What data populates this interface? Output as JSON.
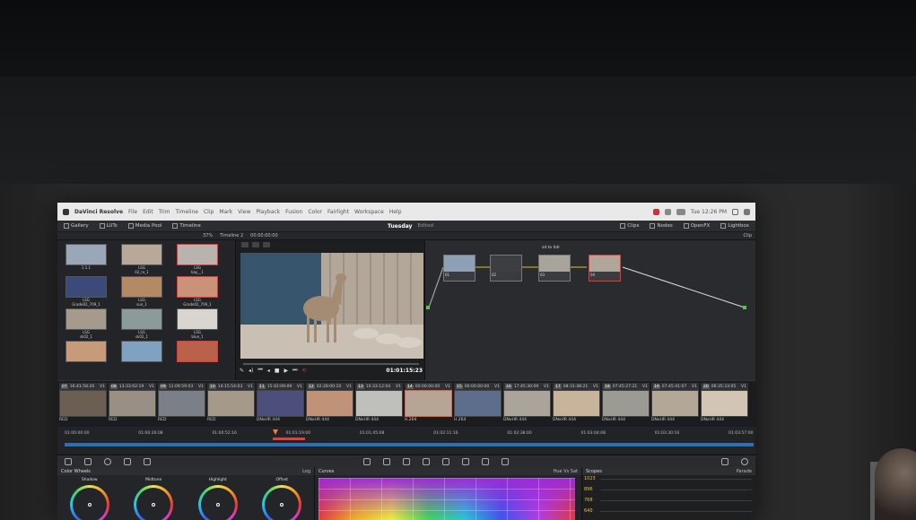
{
  "menubar": {
    "app_name": "DaVinci Resolve",
    "items": [
      "File",
      "Edit",
      "Trim",
      "Timeline",
      "Clip",
      "Mark",
      "View",
      "Playback",
      "Fusion",
      "Color",
      "Fairlight",
      "Workspace",
      "Help"
    ],
    "clock": "Tue 12:26 PM"
  },
  "toolbar": {
    "gallery": "Gallery",
    "luts": "LUTs",
    "media_pool": "Media Pool",
    "timeline": "Timeline",
    "project_title": "Tuesday",
    "edited": "Edited",
    "clips": "Clips",
    "nodes": "Nodes",
    "openfx": "OpenFX",
    "lightbox": "Lightbox"
  },
  "subbar": {
    "zoom": "37%",
    "timeline_name": "Timeline 2",
    "source_tc": "00:00:00:00",
    "clip_label": "Clip"
  },
  "gallery": {
    "stills": [
      {
        "label": "1.1.1",
        "color": "#9aa7b8"
      },
      {
        "label": "LSG\n02_re_1",
        "color": "#b8a89a"
      },
      {
        "label": "LSG\nbay__1",
        "color": "#b9b3b0"
      },
      {
        "label": "LSG\nGrade02_709_1",
        "color": "#3c4a7a"
      },
      {
        "label": "LSG\nsun_1",
        "color": "#b48a64"
      },
      {
        "label": "LSG\nGrade02_709_1",
        "color": "#c9937a"
      },
      {
        "label": "LSG\nsk02_1",
        "color": "#a59b8d"
      },
      {
        "label": "LSG\nsk02_1",
        "color": "#8b9b99"
      },
      {
        "label": "LSG\nblue_1",
        "color": "#d9d6d2"
      },
      {
        "label": "",
        "color": "#c79a7a"
      },
      {
        "label": "",
        "color": "#7fa2c2"
      },
      {
        "label": "",
        "color": "#b9614a"
      }
    ]
  },
  "viewer": {
    "timecode": "01:01:15:23"
  },
  "nodes": {
    "items": [
      {
        "label": "01",
        "title": ""
      },
      {
        "label": "02",
        "title": ""
      },
      {
        "label": "03",
        "title": "sd to hdr"
      },
      {
        "label": "04",
        "title": ""
      }
    ]
  },
  "clips": [
    {
      "num": "07",
      "tc": "16:41:58:20",
      "track": "V1",
      "codec": "RED",
      "color": "#6b5e52"
    },
    {
      "num": "08",
      "tc": "13:33:02:19",
      "track": "V1",
      "codec": "RED",
      "color": "#9a8f84"
    },
    {
      "num": "09",
      "tc": "11:09:59:03",
      "track": "V1",
      "codec": "RED",
      "color": "#7a7f88"
    },
    {
      "num": "10",
      "tc": "14:15:54:03",
      "track": "V1",
      "codec": "RED",
      "color": "#a59a8a"
    },
    {
      "num": "11",
      "tc": "15:42:09:09",
      "track": "V1",
      "codec": "DNxHR 444",
      "color": "#4b4f7a"
    },
    {
      "num": "12",
      "tc": "02:28:00:10",
      "track": "V1",
      "codec": "DNxHR 444",
      "color": "#c09378"
    },
    {
      "num": "13",
      "tc": "10:33:12:04",
      "track": "V1",
      "codec": "DNxHR 444",
      "color": "#bfc0bc"
    },
    {
      "num": "14",
      "tc": "00:00:00:00",
      "track": "V1",
      "codec": "H.264",
      "color": "#b6a595"
    },
    {
      "num": "15",
      "tc": "00:00:00:00",
      "track": "V1",
      "codec": "H.264",
      "color": "#5c6e8c"
    },
    {
      "num": "16",
      "tc": "17:45:30:09",
      "track": "V1",
      "codec": "DNxHR 444",
      "color": "#aaa49b"
    },
    {
      "num": "17",
      "tc": "08:31:48:21",
      "track": "V1",
      "codec": "DNxHR 444",
      "color": "#c8b39b"
    },
    {
      "num": "18",
      "tc": "07:45:27:21",
      "track": "V1",
      "codec": "DNxHR 444",
      "color": "#9b9b94"
    },
    {
      "num": "19",
      "tc": "07:45:41:07",
      "track": "V1",
      "codec": "DNxHR 444",
      "color": "#b3a898"
    },
    {
      "num": "20",
      "tc": "06:35:33:05",
      "track": "V1",
      "codec": "DNxHR 444",
      "color": "#d2c5b4"
    }
  ],
  "timeline": {
    "ruler": [
      "01:00:00:00",
      "01:00:26:08",
      "01:00:52:16",
      "01:01:19:00",
      "01:01:45:08",
      "01:02:11:16",
      "01:02:38:00",
      "01:03:04:08",
      "01:03:30:16",
      "01:03:57:00"
    ]
  },
  "color_wheels": {
    "title": "Color Wheels",
    "mode": "Log",
    "wheels": [
      "Shadow",
      "Midtone",
      "Highlight",
      "Offset"
    ]
  },
  "curves": {
    "title": "Curves",
    "mode": "Hue Vs Sat"
  },
  "scopes": {
    "title": "Scopes",
    "mode": "Parade",
    "levels": [
      "1023",
      "896",
      "768",
      "640"
    ],
    "accent": "#e7c23a"
  }
}
